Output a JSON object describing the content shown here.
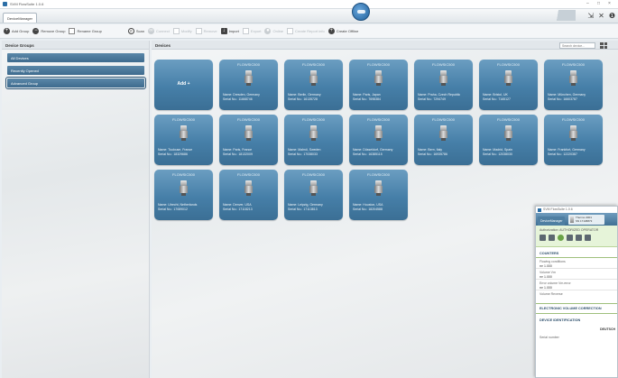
{
  "window": {
    "title": "SVM FlowSuite 1.0.6",
    "controls": [
      "–",
      "□",
      "×"
    ]
  },
  "tabbar": {
    "active_tab": "DeviceManager",
    "icons": [
      "collapse-icon",
      "tools-icon",
      "help-icon"
    ]
  },
  "toolbar": {
    "left": [
      {
        "label": "Add Group",
        "icon": "plus-icon",
        "enabled": true
      },
      {
        "label": "Remove Group",
        "icon": "minus-icon",
        "enabled": true
      },
      {
        "label": "Rename Group",
        "icon": "edit-icon",
        "enabled": true
      }
    ],
    "right": [
      {
        "label": "Scan",
        "icon": "search-icon",
        "enabled": true
      },
      {
        "label": "Connect",
        "icon": "link-icon",
        "enabled": false
      },
      {
        "label": "Modify",
        "icon": "edit-icon",
        "enabled": false
      },
      {
        "label": "Remove",
        "icon": "trash-icon",
        "enabled": false
      },
      {
        "label": "Import",
        "icon": "import-icon",
        "enabled": true
      },
      {
        "label": "Export",
        "icon": "export-icon",
        "enabled": false
      },
      {
        "label": "Online",
        "icon": "online-icon",
        "enabled": false
      },
      {
        "label": "Create Report info",
        "icon": "report-icon",
        "enabled": false
      },
      {
        "label": "Create Offline",
        "icon": "plus-icon",
        "enabled": true
      }
    ]
  },
  "left_panel": {
    "title": "Device Groups",
    "groups": [
      {
        "label": "All Devices",
        "selected": false
      },
      {
        "label": "Recently Opened",
        "selected": false
      },
      {
        "label": "Advanced Group",
        "selected": true
      }
    ]
  },
  "main": {
    "title": "Devices",
    "search_placeholder": "Search device...",
    "add_label": "Add +",
    "name_prefix": "Name:",
    "serial_prefix": "Serial No.:",
    "devices": [
      {
        "model": "FLOWSIC500",
        "name": "Dresden, Germany",
        "serial": "11668746"
      },
      {
        "model": "FLOWSIC500",
        "name": "Berlin, Germany",
        "serial": "16135728"
      },
      {
        "model": "FLOWSIC500",
        "name": "Paris, Japan",
        "serial": "7698384"
      },
      {
        "model": "FLOWSIC500",
        "name": "Praha, Czech Republic",
        "serial": "7294749"
      },
      {
        "model": "FLOWSIC500",
        "name": "Bristol, UK",
        "serial": "7165127"
      },
      {
        "model": "FLOWSIC500",
        "name": "München, Germany",
        "serial": "16603787"
      },
      {
        "model": "FLOWSIC500",
        "name": "Toulouse, France",
        "serial": "18329686"
      },
      {
        "model": "FLOWSIC500",
        "name": "Paris, France",
        "serial": "18132009"
      },
      {
        "model": "FLOWSIC500",
        "name": "Malmö, Sweden",
        "serial": "17038033"
      },
      {
        "model": "FLOWSIC500",
        "name": "Düsseldorf, Germany",
        "serial": "16385115"
      },
      {
        "model": "FLOWSIC500",
        "name": "Bern, Italy",
        "serial": "16935786"
      },
      {
        "model": "FLOWSIC500",
        "name": "Madrid, Spain",
        "serial": "12038030"
      },
      {
        "model": "FLOWSIC500",
        "name": "Frankfurt, Germany",
        "serial": "12220387"
      },
      {
        "model": "FLOWSIC500",
        "name": "Utrecht, Netherlands",
        "serial": "17089012"
      },
      {
        "model": "FLOWSIC500",
        "name": "Denver, USA",
        "serial": "17118213"
      },
      {
        "model": "FLOWSIC500",
        "name": "Leipzig, Germany",
        "serial": "17113813"
      },
      {
        "model": "FLOWSIC500",
        "name": "Houston, USA",
        "serial": "18204588"
      }
    ]
  },
  "popup": {
    "title": "SVM FlowSuite 1.0.6",
    "tab": "DeviceManager",
    "device_line1": "Thermo-3001",
    "device_line2": "SN 17108873",
    "status_line": "Authorization: AUTHORIZED OPERATOR",
    "sections": {
      "counters": "COUNTERS",
      "counter_rows": [
        {
          "label": "Flowing conditions",
          "value": "m³ 1.000"
        },
        {
          "label": "Volume Vm",
          "value": "m³ 1.000"
        },
        {
          "label": "Error volume Vm.error",
          "value": "m³ 1.000"
        }
      ],
      "volume_reverse": "Volume Reverse",
      "electronic": "ELECTRONIC VOLUME CORRECTION",
      "identification": "DEVICE IDENTIFICATION",
      "ident_value": "DEUTSCH",
      "serial_label": "Serial number"
    }
  }
}
